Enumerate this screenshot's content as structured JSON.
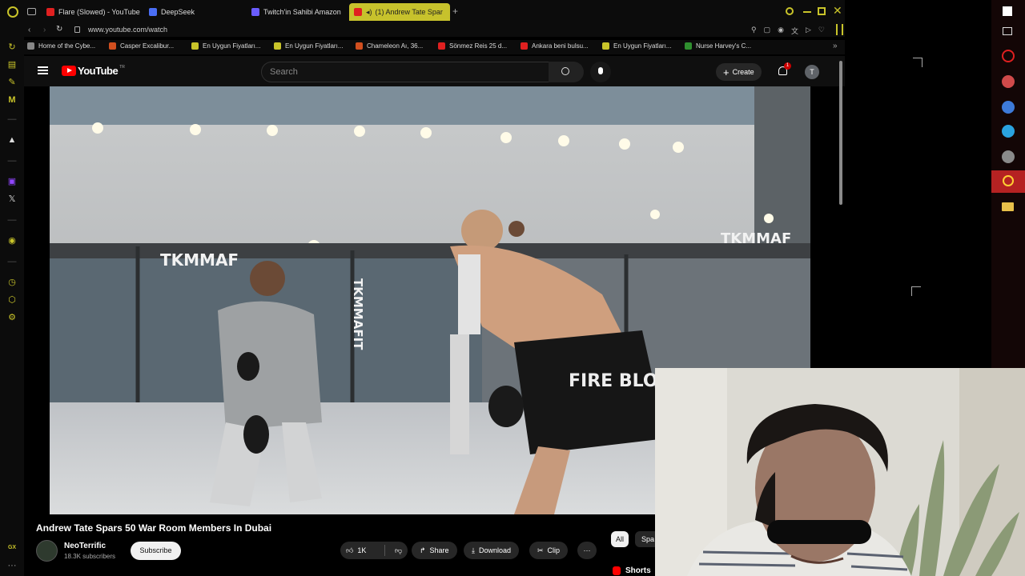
{
  "tabs": [
    {
      "label": "Flare (Slowed) - YouTube",
      "color": "#e02020",
      "active": false
    },
    {
      "label": "DeepSeek",
      "color": "#4a6ef5",
      "active": false
    },
    {
      "label": "Twitch'in Sahibi Amazon",
      "color": "#6a5cff",
      "active": false
    },
    {
      "label": "(1) Andrew Tate Spar",
      "color": "#e02020",
      "active": true
    }
  ],
  "address": {
    "url": "www.youtube.com/watch"
  },
  "bookmarks": [
    {
      "label": "Home of the Cybe...",
      "color": "#888888"
    },
    {
      "label": "Casper Excalibur...",
      "color": "#d14f1f"
    },
    {
      "label": "En Uygun Fiyatları...",
      "color": "#c9c42a"
    },
    {
      "label": "En Uygun Fiyatları...",
      "color": "#c9c42a"
    },
    {
      "label": "Chameleon Aı, 36...",
      "color": "#d14f1f"
    },
    {
      "label": "Sönmez Reis 25 d...",
      "color": "#e02020"
    },
    {
      "label": "Ankara beni bulsu...",
      "color": "#e02020"
    },
    {
      "label": "En Uygun Fiyatları...",
      "color": "#c9c42a"
    },
    {
      "label": "Nurse Harvey's C...",
      "color": "#2f8f2f"
    }
  ],
  "youtube": {
    "logo_text": "YouTube",
    "region": "TR",
    "search_placeholder": "Search",
    "create_label": "Create",
    "notification_count": "1",
    "avatar_letter": "T"
  },
  "video": {
    "title": "Andrew Tate Spars 50 War Room Members In Dubai",
    "channel": "NeoTerrific",
    "subscribers": "18.3K subscribers",
    "subscribe_label": "Subscribe",
    "likes": "1K",
    "share_label": "Share",
    "download_label": "Download",
    "clip_label": "Clip",
    "brand_text": "TKMMAFIT",
    "cage_text": "TKMMAF",
    "shorts_text": "FIRE BLOOD"
  },
  "chips": {
    "all": "All",
    "second": "Spa"
  },
  "shorts_label": "Shorts",
  "sidebar_gx": "GX",
  "colors": {
    "accent": "#c9c42a",
    "yt_red": "#ff0000",
    "bg": "#0f0f0f"
  }
}
